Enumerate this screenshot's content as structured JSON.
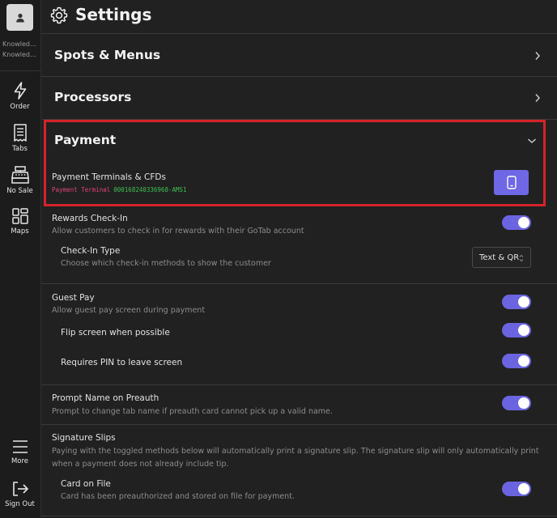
{
  "sidebar": {
    "account_line1": "Knowledge Base",
    "account_line2": "Knowledge Base",
    "nav": [
      {
        "label": "Order",
        "icon": "lightning-icon"
      },
      {
        "label": "Tabs",
        "icon": "receipt-icon"
      },
      {
        "label": "No Sale",
        "icon": "cash-register-icon"
      },
      {
        "label": "Maps",
        "icon": "grid-layout-icon"
      }
    ],
    "more_label": "More",
    "signout_label": "Sign Out"
  },
  "header": {
    "title": "Settings"
  },
  "sections": {
    "spots_menus": "Spots & Menus",
    "processors": "Processors",
    "payment": "Payment"
  },
  "payment": {
    "terminals_title": "Payment Terminals & CFDs",
    "terminal_key": "Payment Terminal",
    "terminal_value": "000168240336968-AMS1"
  },
  "rewards": {
    "title": "Rewards Check-In",
    "desc": "Allow customers to check in for rewards with their GoTab account",
    "enabled": true,
    "checkin_type_title": "Check-In Type",
    "checkin_type_desc": "Choose which check-in methods to show the customer",
    "checkin_type_value": "Text & QR"
  },
  "guest_pay": {
    "title": "Guest Pay",
    "desc": "Allow guest pay screen during payment",
    "enabled": true,
    "flip_title": "Flip screen when possible",
    "flip_enabled": true,
    "pin_title": "Requires PIN to leave screen",
    "pin_enabled": true
  },
  "prompt_name": {
    "title": "Prompt Name on Preauth",
    "desc": "Prompt to change tab name if preauth card cannot pick up a valid name.",
    "enabled": true
  },
  "signature": {
    "title": "Signature Slips",
    "desc1": "Paying with the toggled methods below will automatically print a signature slip. The signature slip will only automatically print",
    "desc2": "when a payment does not already include tip.",
    "card_title": "Card on File",
    "card_desc": "Card has been preauthorized and stored on file for payment.",
    "card_enabled": true
  },
  "colors": {
    "accent": "#6b64e0",
    "highlight_border": "#d6232a",
    "terminal_key": "#e0457b",
    "terminal_value": "#3fbf4f"
  }
}
